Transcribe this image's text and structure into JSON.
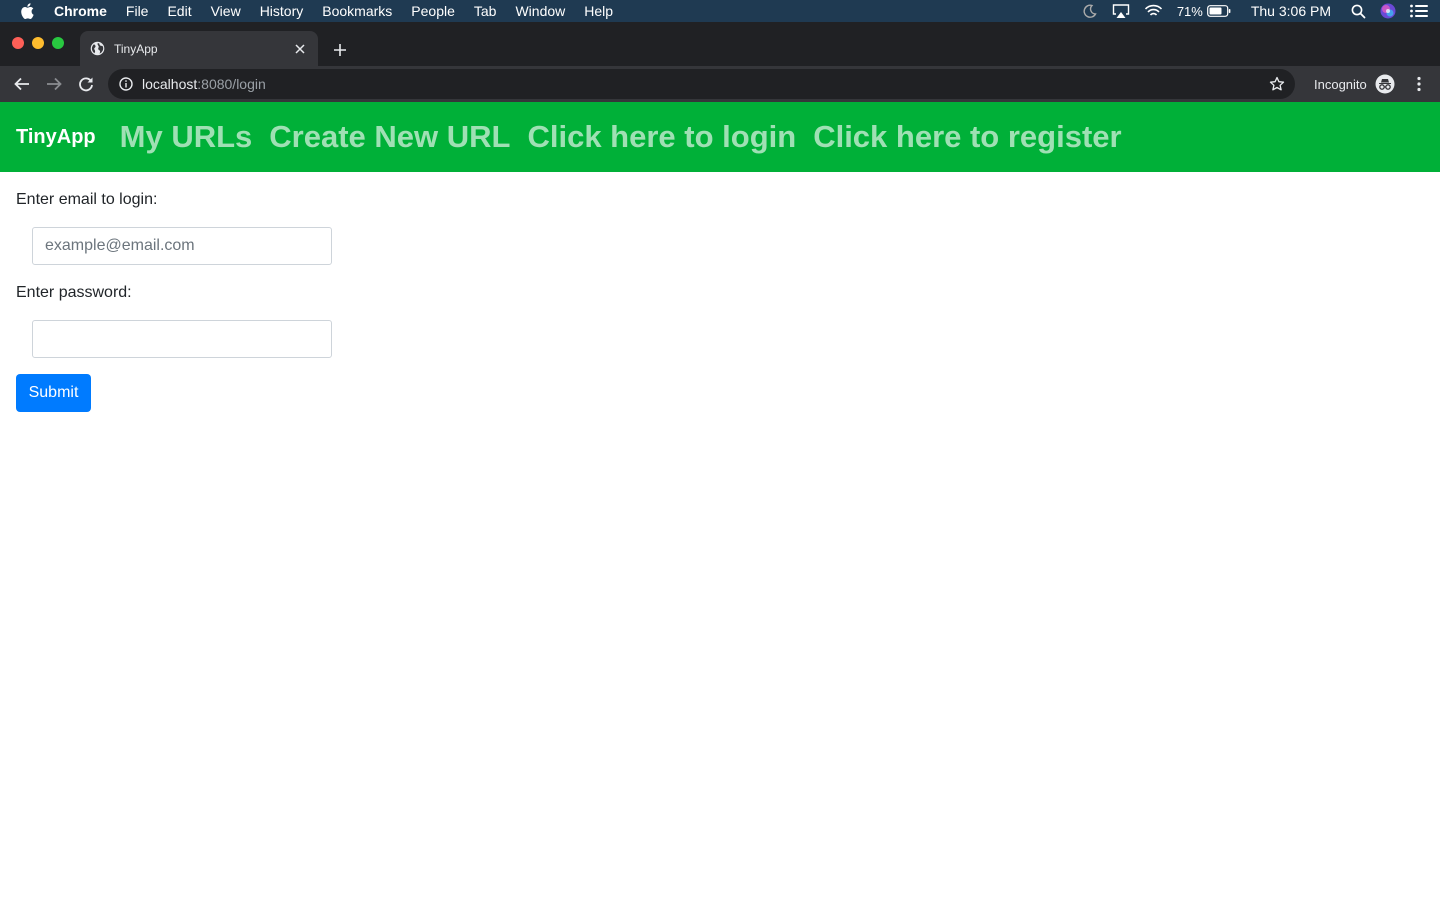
{
  "menubar": {
    "app": "Chrome",
    "items": [
      "File",
      "Edit",
      "View",
      "History",
      "Bookmarks",
      "People",
      "Tab",
      "Window",
      "Help"
    ],
    "battery": "71%",
    "clock": "Thu 3:06 PM"
  },
  "browser": {
    "tab_title": "TinyApp",
    "url_host": "localhost",
    "url_rest": ":8080/login",
    "profile_label": "Incognito"
  },
  "nav": {
    "brand": "TinyApp",
    "links": [
      "My URLs",
      "Create New URL",
      "Click here to login",
      "Click here to register"
    ]
  },
  "form": {
    "email_label": "Enter email to login:",
    "email_placeholder": "example@email.com",
    "email_value": "",
    "password_label": "Enter password:",
    "password_value": "",
    "submit_label": "Submit"
  },
  "colors": {
    "nav_bg": "#00b038",
    "nav_link": "#9fe0b4",
    "submit_bg": "#007bff"
  }
}
